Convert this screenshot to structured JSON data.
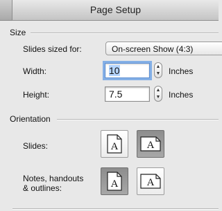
{
  "window": {
    "title": "Page Setup"
  },
  "size": {
    "section_label": "Size",
    "slides_sized_for_label": "Slides sized for:",
    "slides_sized_for_value": "On-screen Show (4:3)",
    "width_label": "Width:",
    "width_value": "10",
    "width_unit": "Inches",
    "height_label": "Height:",
    "height_value": "7.5",
    "height_unit": "Inches"
  },
  "orientation": {
    "section_label": "Orientation",
    "slides_label": "Slides:",
    "notes_label_line1": "Notes, handouts",
    "notes_label_line2": "& outlines:",
    "icon_letter": "A",
    "slides_selected": "landscape",
    "notes_selected": "portrait"
  }
}
